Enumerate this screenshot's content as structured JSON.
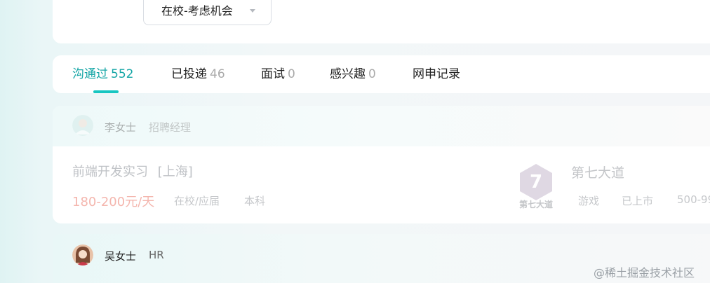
{
  "filter": {
    "status_dropdown": "在校-考虑机会"
  },
  "tabs": [
    {
      "label": "沟通过",
      "count": "552"
    },
    {
      "label": "已投递",
      "count": "46"
    },
    {
      "label": "面试",
      "count": "0"
    },
    {
      "label": "感兴趣",
      "count": "0"
    },
    {
      "label": "网申记录",
      "count": ""
    }
  ],
  "job_cards": [
    {
      "recruiter_name": "李女士",
      "recruiter_title": "招聘经理",
      "job_title": "前端开发实习",
      "job_location": "[上海]",
      "salary": "180-200元/天",
      "job_tags": [
        "在校/应届",
        "本科"
      ],
      "company_name": "第七大道",
      "company_logo_text": "第七大道",
      "company_logo_mark": "7",
      "company_tags": [
        "游戏",
        "已上市",
        "500-99"
      ]
    },
    {
      "recruiter_name": "吴女士",
      "recruiter_title": "HR"
    }
  ],
  "watermark": "@稀土掘金技术社区",
  "colors": {
    "accent": "#15a6a6",
    "underline": "#17c6c1",
    "salary": "#f4b6ae"
  }
}
